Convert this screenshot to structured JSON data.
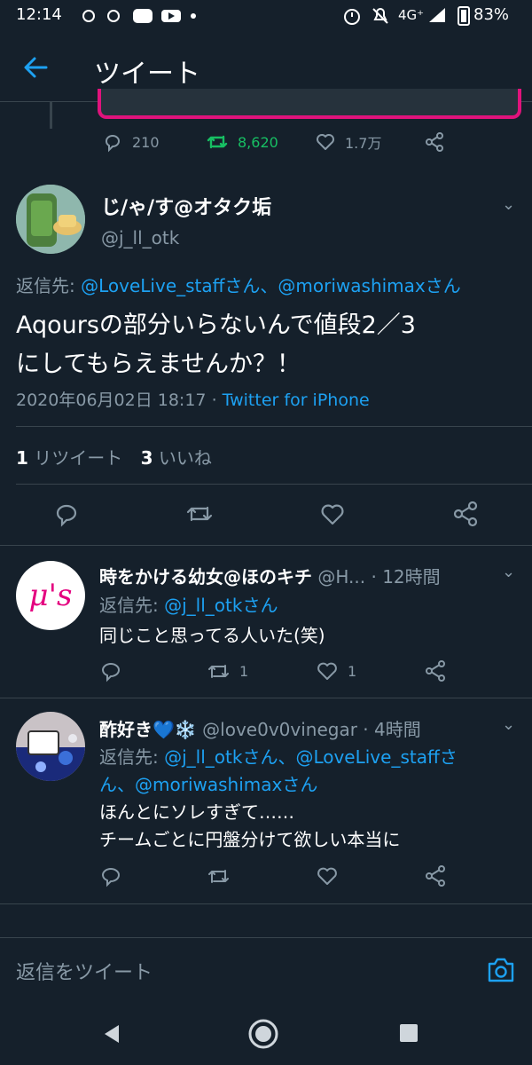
{
  "status_bar": {
    "time": "12:14",
    "network": "4G⁺",
    "battery": "83%"
  },
  "header": {
    "title": "ツイート"
  },
  "prev_tweet": {
    "reply_count": "210",
    "retweet_count": "8,620",
    "like_count": "1.7万"
  },
  "main_tweet": {
    "display_name": "じ/ゃ/す@オタク垢",
    "handle": "@j_ll_otk",
    "reply_prefix": "返信先:",
    "reply_to": "@LoveLive_staffさん、@moriwashimaxさん",
    "text_line1": "Aqoursの部分いらないんで値段2／3",
    "text_line2": "にしてもらえませんか？！",
    "timestamp": "2020年06月02日 18:17",
    "separator": "·",
    "client": "Twitter for iPhone",
    "retweets_count": "1",
    "retweets_label": "リツイート",
    "likes_count": "3",
    "likes_label": "いいね"
  },
  "replies": [
    {
      "display_name": "時をかける幼女@ほのキチ",
      "handle": "@H...",
      "time": "· 12時間",
      "reply_prefix": "返信先:",
      "reply_line1": "@j_ll_otkさん",
      "reply_line2": "",
      "text_line1": "同じこと思ってる人いた(笑)",
      "text_line2": "",
      "retweet_count": "1",
      "like_count": "1",
      "avatar_text": "μ's"
    },
    {
      "display_name": "酢好き💙❄️",
      "handle": "@love0v0vinegar",
      "time": "· 4時間",
      "reply_prefix": "返信先:",
      "reply_line1": "@j_ll_otkさん、@LoveLive_staffさ",
      "reply_line2": "ん、@moriwashimaxさん",
      "text_line1": "ほんとにソレすぎて……",
      "text_line2": "チームごとに円盤分けて欲しい本当に",
      "retweet_count": "",
      "like_count": ""
    }
  ],
  "reply_bar": {
    "placeholder": "返信をツイート"
  },
  "colors": {
    "background": "#15202b",
    "accent": "#1da1f2",
    "muted": "#8899a6",
    "retweet_green": "#17bf63",
    "divider": "#38444d"
  }
}
